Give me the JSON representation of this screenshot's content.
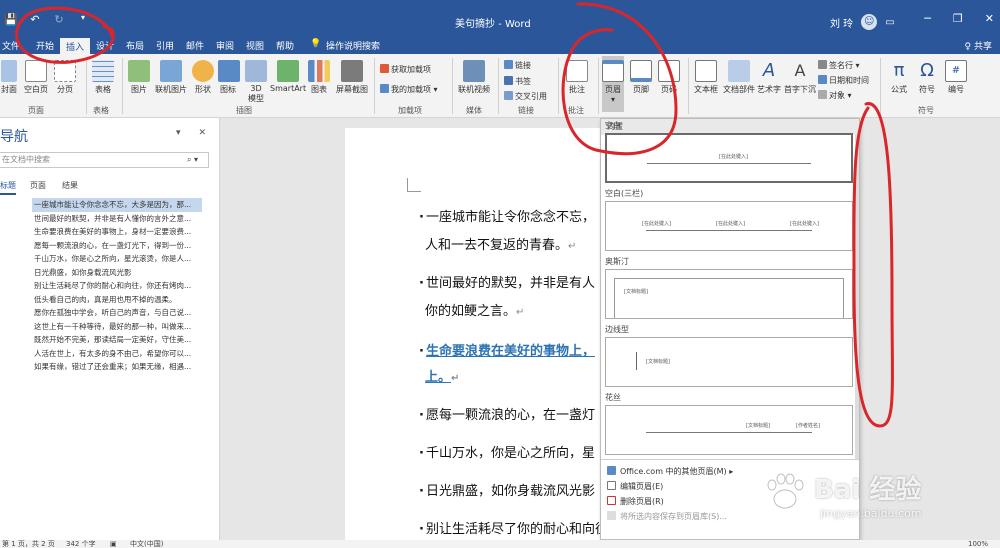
{
  "titlebar": {
    "doc_title": "美句摘抄 - Word",
    "user_name": "刘 玲",
    "avatar_glyph": "☺",
    "share": "♀ 共享"
  },
  "tabs": [
    {
      "label": "文件"
    },
    {
      "label": "开始"
    },
    {
      "label": "插入"
    },
    {
      "label": "设计"
    },
    {
      "label": "布局"
    },
    {
      "label": "引用"
    },
    {
      "label": "邮件"
    },
    {
      "label": "审阅"
    },
    {
      "label": "视图"
    },
    {
      "label": "帮助"
    },
    {
      "label": "操作说明搜索"
    }
  ],
  "ribbon": {
    "buttons": [
      {
        "label": "封面"
      },
      {
        "label": "空白页"
      },
      {
        "label": "分页"
      },
      {
        "label": "表格"
      },
      {
        "label": "图片"
      },
      {
        "label": "联机图片"
      },
      {
        "label": "形状"
      },
      {
        "label": "图标"
      },
      {
        "label": "3D\n模型"
      },
      {
        "label": "SmartArt"
      },
      {
        "label": "图表"
      },
      {
        "label": "屏幕截图"
      },
      {
        "label": "联机视频"
      },
      {
        "label": "批注"
      },
      {
        "label": "页眉"
      },
      {
        "label": "页脚"
      },
      {
        "label": "页码"
      },
      {
        "label": "文本框"
      },
      {
        "label": "文档部件"
      },
      {
        "label": "艺术字"
      },
      {
        "label": "首字下沉"
      },
      {
        "label": "公式"
      },
      {
        "label": "符号"
      },
      {
        "label": "编号"
      }
    ],
    "small": [
      {
        "label": "获取加载项"
      },
      {
        "label": "我的加载项"
      },
      {
        "label": "链接"
      },
      {
        "label": "书签"
      },
      {
        "label": "交叉引用"
      },
      {
        "label": "签名行"
      },
      {
        "label": "日期和时间"
      },
      {
        "label": "对象"
      }
    ],
    "groups": [
      {
        "label": "页面"
      },
      {
        "label": "表格"
      },
      {
        "label": "插图"
      },
      {
        "label": "加载项"
      },
      {
        "label": "媒体"
      },
      {
        "label": "链接"
      },
      {
        "label": "批注"
      },
      {
        "label": "符号"
      }
    ]
  },
  "nav": {
    "title": "导航",
    "search_placeholder": "在文档中搜索",
    "tabs": [
      {
        "label": "标题"
      },
      {
        "label": "页面"
      },
      {
        "label": "结果"
      }
    ],
    "headings": [
      "一座城市能让令你念念不忘，大多是因为，那...",
      "世间最好的默契，并非是有人懂你的言外之意...",
      "生命要浪费在美好的事物上，身材一定要浪费...",
      "愿每一颗流浪的心，在一盏灯光下，得到一份...",
      "千山万水，你是心之所向，星光滚烫，你是人...",
      "日光鼎盛，如你身载流风光影",
      "别让生活耗尽了你的耐心和向往，你还有烤肉...",
      "低头看自己的肉，真是用也甩不掉的温柔。",
      "愿你在孤独中学会，听自己的声音，与自己说...",
      "这世上有一千种等待，最好的那一种，叫做来...",
      "既然开始不完美，那读结局一定美好，守住美...",
      "人活在世上，有太多的身不由己，希望你可以...",
      "如果有缘，错过了还会重来；如果无缘，相遇..."
    ]
  },
  "document": {
    "paragraphs": [
      {
        "text": "一座城市能让令你念念不忘，",
        "mark": ""
      },
      {
        "text": "人和一去不复返的青春。",
        "mark": "↵"
      },
      {
        "text": "世间最好的默契，并非是有人",
        "mark": ""
      },
      {
        "text": "你的如鲠之言。",
        "mark": "↵"
      },
      {
        "text": "生命要浪费在美好的事物上，",
        "mark": ""
      },
      {
        "text": "上。",
        "mark": "↵"
      },
      {
        "text": "愿每一颗流浪的心，在一盏灯",
        "mark": ""
      },
      {
        "text": "千山万水，你是心之所向，星",
        "mark": ""
      },
      {
        "text": "日光鼎盛，如你身载流风光影",
        "mark": ""
      },
      {
        "text": "别让生活耗尽了你的耐心和向往，你还有烤肉和刷肥羊·烧烤",
        "mark": ""
      }
    ]
  },
  "header_gallery": {
    "section": "内置",
    "items": [
      {
        "label": "空白",
        "placeholders": [
          "[在此处键入]"
        ]
      },
      {
        "label": "空白(三栏)",
        "placeholders": [
          "[在此处键入]",
          "[在此处键入]",
          "[在此处键入]"
        ]
      },
      {
        "label": "奥斯汀",
        "placeholders": [
          "[文档标题]"
        ]
      },
      {
        "label": "边线型",
        "placeholders": [
          "[文档标题]"
        ]
      },
      {
        "label": "花丝",
        "placeholders": [
          "[文档标题]",
          "[作者姓名]"
        ]
      }
    ],
    "menu": [
      {
        "label": "Office.com 中的其他页眉(M)"
      },
      {
        "label": "编辑页眉(E)"
      },
      {
        "label": "删除页眉(R)"
      },
      {
        "label": "将所选内容保存到页眉库(S)..."
      }
    ]
  },
  "statusbar": {
    "page": "第 1 页，共 2 页",
    "words": "342 个字",
    "lang": "中文(中国)",
    "zoom": "100%"
  },
  "watermark": {
    "brand": "Bai 经验",
    "url": "jingyan.baidu.com"
  },
  "colors": {
    "word_blue": "#2b579a",
    "heading_blue": "#2e74b5",
    "annotation_red": "#d9262b"
  }
}
